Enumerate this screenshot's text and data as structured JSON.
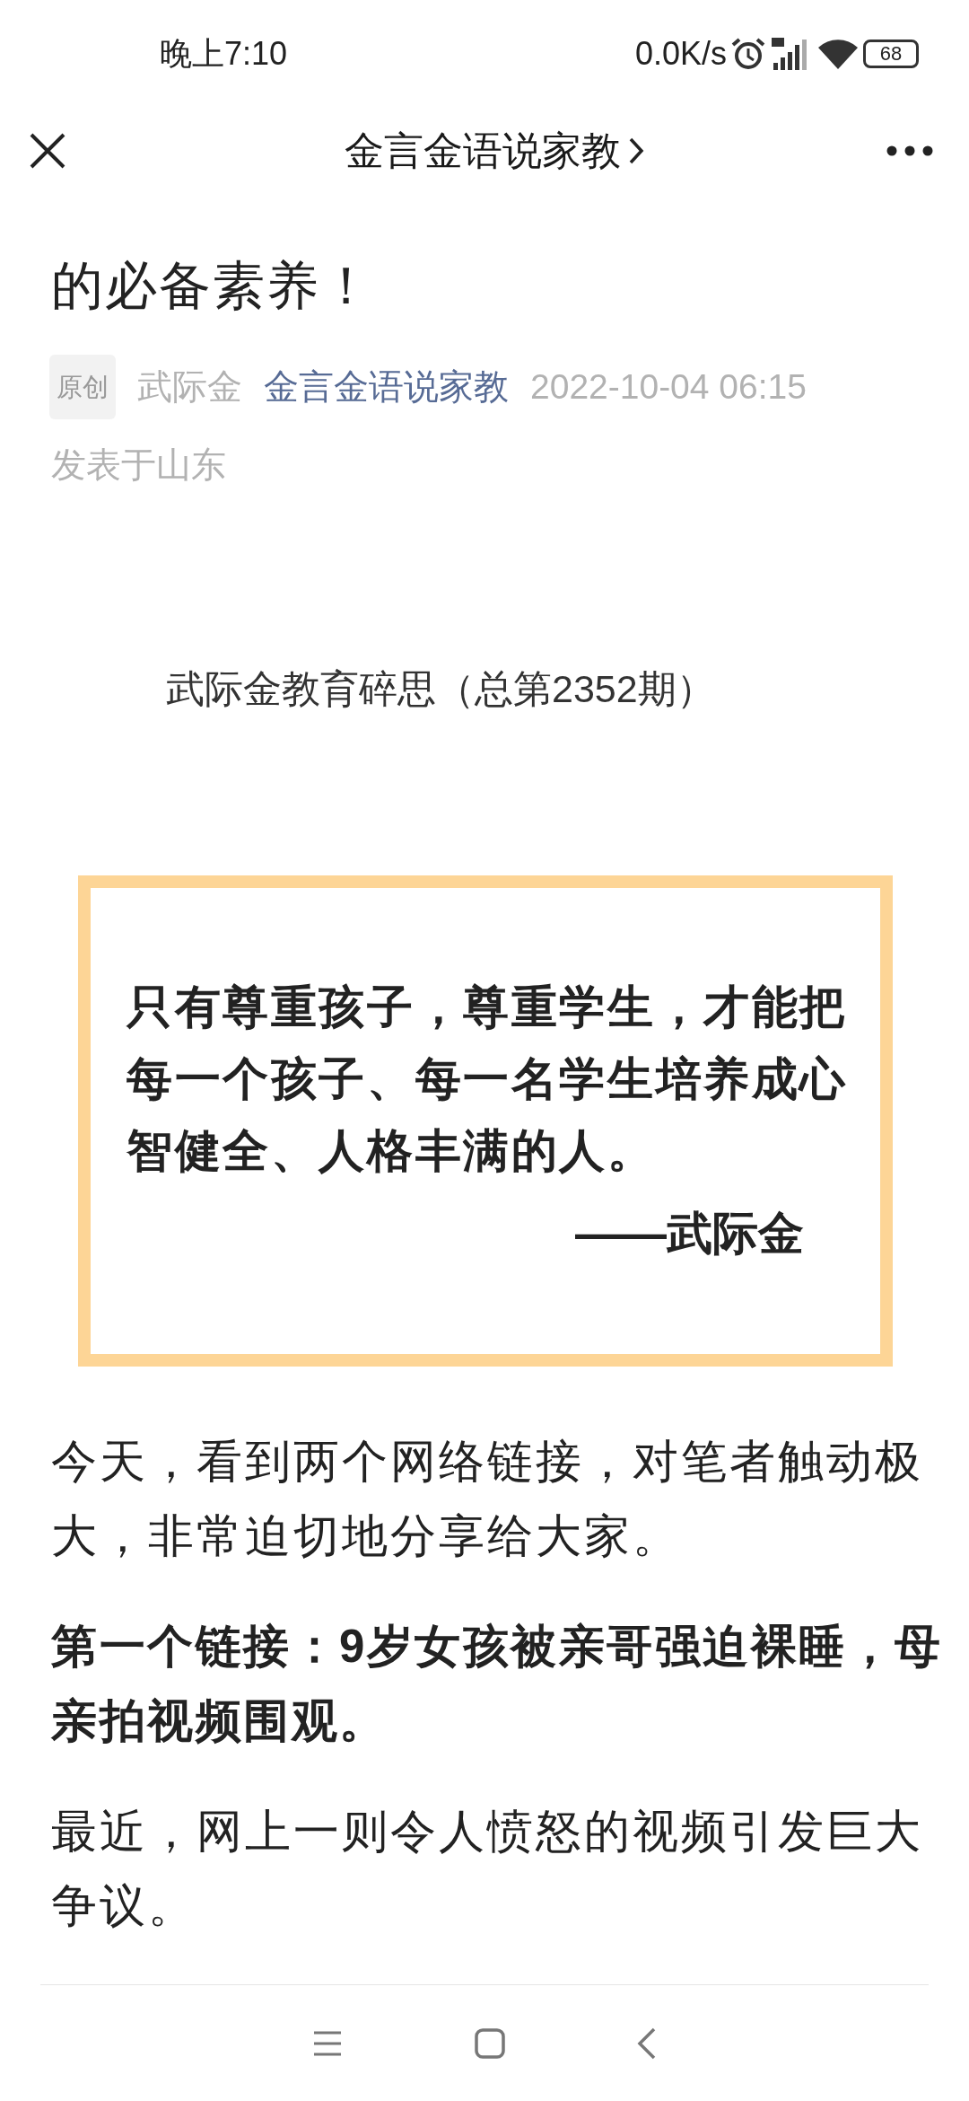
{
  "status_bar": {
    "time": "晚上7:10",
    "network_speed": "0.0K/s",
    "battery": "68"
  },
  "header": {
    "title": "金言金语说家教"
  },
  "article": {
    "title": "的必备素养！",
    "badge": "原创",
    "author": "武际金",
    "account": "金言金语说家教",
    "date": "2022-10-04 06:15",
    "location": "发表于山东",
    "issue": "武际金教育碎思（总第2352期）",
    "quote": {
      "text": "只有尊重孩子，尊重学生，才能把每一个孩子、每一名学生培养成心智健全、人格丰满的人。",
      "attribution": "——武际金"
    },
    "paragraphs": [
      {
        "text": "今天，看到两个网络链接，对笔者触动极大，非常迫切地分享给大家。",
        "bold": false
      },
      {
        "text": "第一个链接：9岁女孩被亲哥强迫裸睡，母亲拍视频围观。",
        "bold": true
      },
      {
        "text": "最近，网上一则令人愤怒的视频引发巨大争议。",
        "bold": false
      }
    ]
  }
}
